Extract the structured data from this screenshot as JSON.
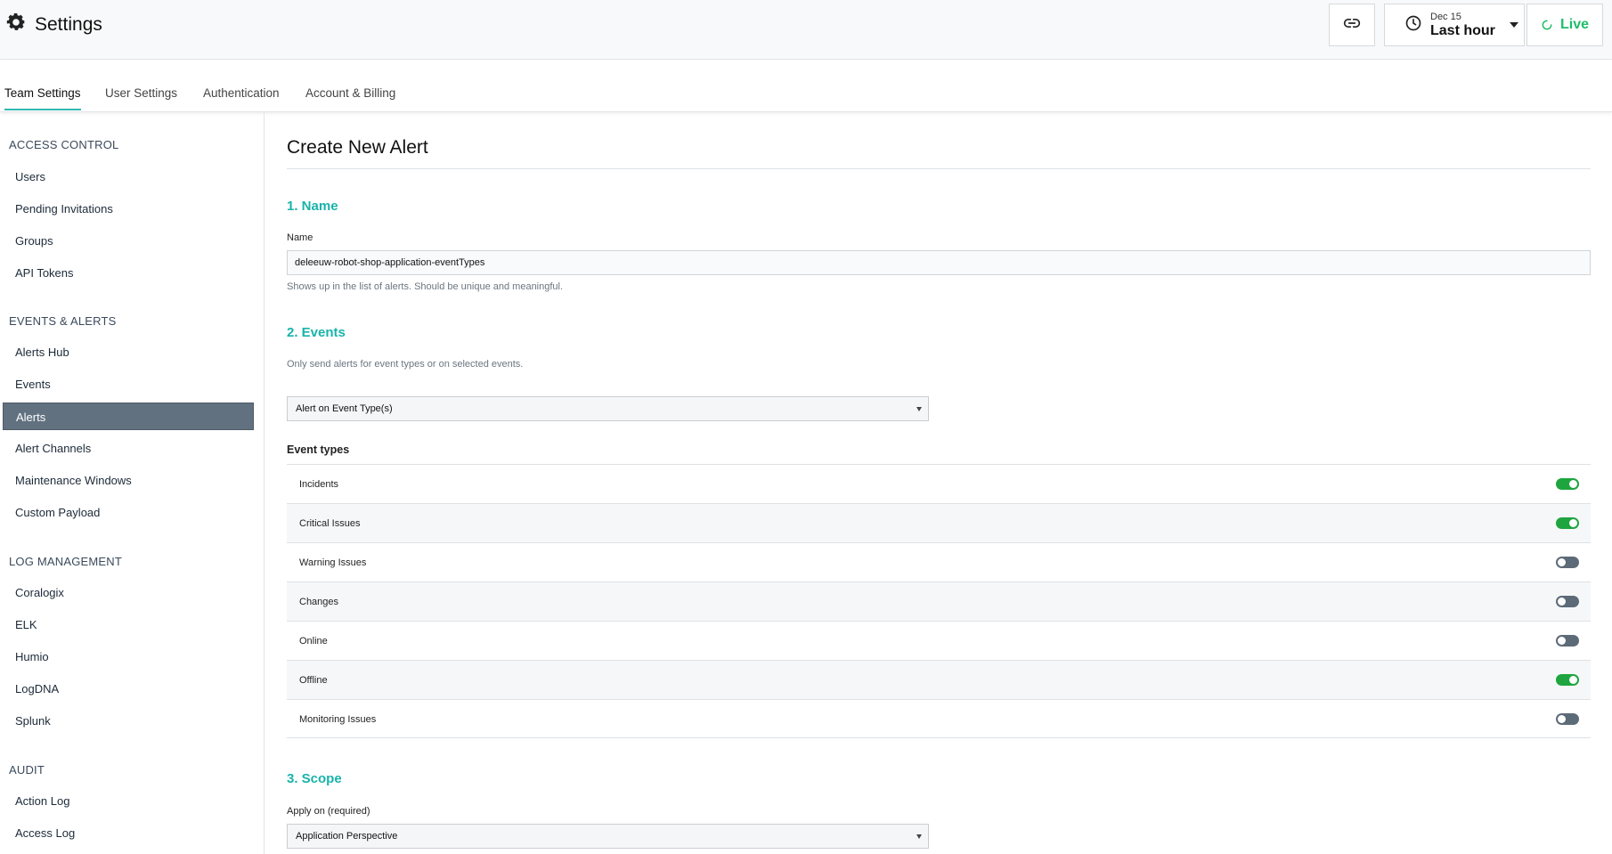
{
  "header": {
    "title": "Settings",
    "time_date": "Dec 15",
    "time_range": "Last hour",
    "live_label": "Live"
  },
  "tabs": [
    {
      "label": "Team Settings",
      "active": true
    },
    {
      "label": "User Settings"
    },
    {
      "label": "Authentication"
    },
    {
      "label": "Account & Billing"
    }
  ],
  "sidebar": {
    "sections": [
      {
        "heading": "ACCESS CONTROL",
        "items": [
          "Users",
          "Pending Invitations",
          "Groups",
          "API Tokens"
        ]
      },
      {
        "heading": "EVENTS & ALERTS",
        "items": [
          "Alerts Hub",
          "Events",
          "Alerts",
          "Alert Channels",
          "Maintenance Windows",
          "Custom Payload"
        ]
      },
      {
        "heading": "LOG MANAGEMENT",
        "items": [
          "Coralogix",
          "ELK",
          "Humio",
          "LogDNA",
          "Splunk"
        ]
      },
      {
        "heading": "AUDIT",
        "items": [
          "Action Log",
          "Access Log"
        ]
      }
    ],
    "active_item": "Alerts"
  },
  "main": {
    "page_title": "Create New Alert",
    "name_section": {
      "title": "1. Name",
      "field_label": "Name",
      "field_value": "deleeuw-robot-shop-application-eventTypes",
      "hint": "Shows up in the list of alerts. Should be unique and meaningful."
    },
    "events_section": {
      "title": "2. Events",
      "description": "Only send alerts for event types or on selected events.",
      "select_value": "Alert on Event Type(s)",
      "event_types_heading": "Event types",
      "event_types": [
        {
          "label": "Incidents",
          "enabled": true
        },
        {
          "label": "Critical Issues",
          "enabled": true
        },
        {
          "label": "Warning Issues",
          "enabled": false
        },
        {
          "label": "Changes",
          "enabled": false
        },
        {
          "label": "Online",
          "enabled": false
        },
        {
          "label": "Offline",
          "enabled": true
        },
        {
          "label": "Monitoring Issues",
          "enabled": false
        }
      ]
    },
    "scope_section": {
      "title": "3. Scope",
      "field_label": "Apply on (required)",
      "select_value": "Application Perspective"
    }
  },
  "colors": {
    "accent": "#19b3aa",
    "live": "#1dbe6a",
    "toggle_on": "#1fa53f",
    "toggle_off": "#5d6a77",
    "nav_active_bg": "#627180"
  }
}
